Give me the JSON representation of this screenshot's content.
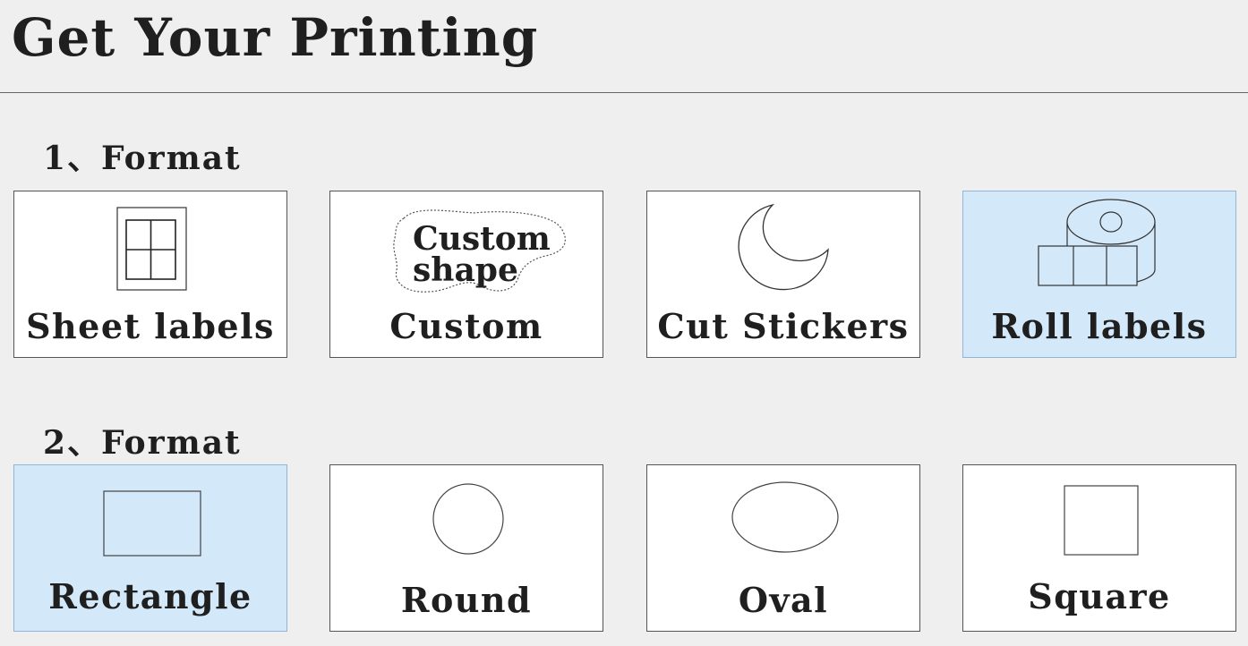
{
  "page": {
    "title": "Get Your Printing"
  },
  "sections": [
    {
      "label": "1、Format",
      "options": [
        {
          "label": "Sheet labels",
          "icon": "sheet-labels-icon",
          "selected": false
        },
        {
          "label": "Custom",
          "icon": "custom-shape-icon",
          "icon_text": [
            "Custom",
            "shape"
          ],
          "selected": false
        },
        {
          "label": "Cut Stickers",
          "icon": "cut-sticker-icon",
          "selected": false
        },
        {
          "label": "Roll labels",
          "icon": "roll-labels-icon",
          "selected": true
        }
      ]
    },
    {
      "label": "2、Format",
      "options": [
        {
          "label": "Rectangle",
          "icon": "rectangle-icon",
          "selected": true
        },
        {
          "label": "Round",
          "icon": "circle-icon",
          "selected": false
        },
        {
          "label": "Oval",
          "icon": "oval-icon",
          "selected": false
        },
        {
          "label": "Square",
          "icon": "square-icon",
          "selected": false
        }
      ]
    }
  ],
  "colors": {
    "background": "#efefef",
    "card": "#ffffff",
    "selected_card": "#d3e8f9",
    "text": "#1f1f1f"
  }
}
